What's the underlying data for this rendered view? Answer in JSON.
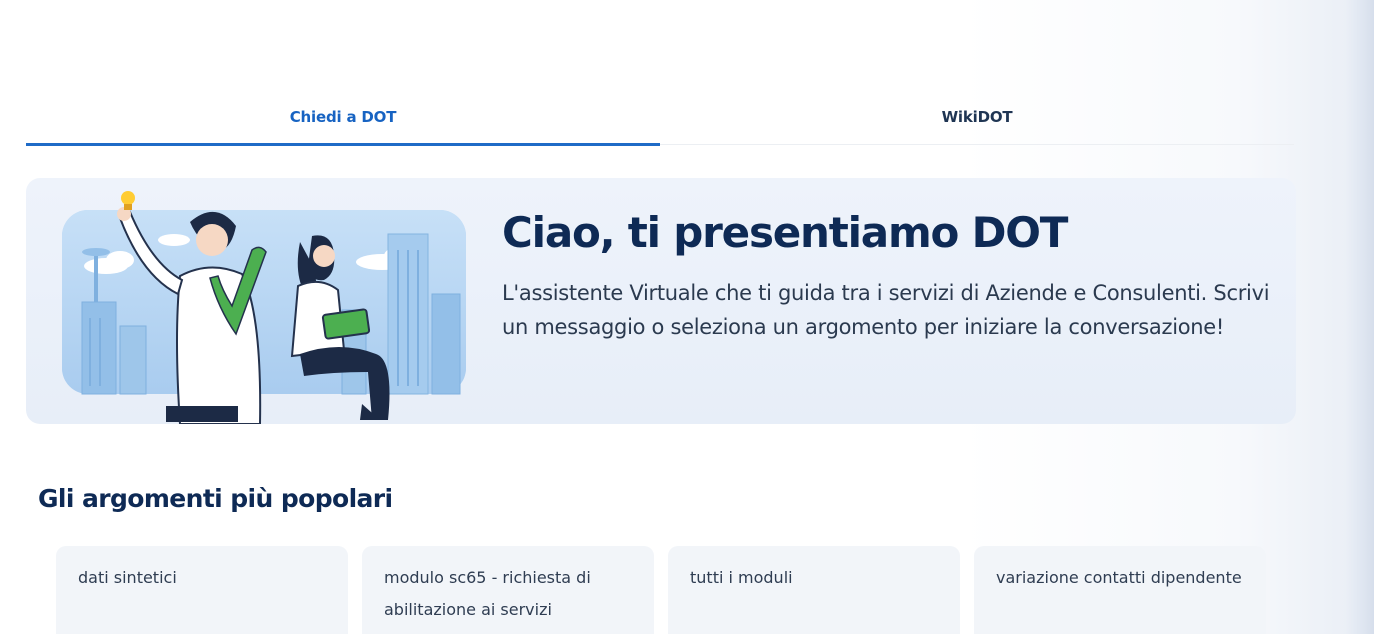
{
  "tabs": [
    {
      "label": "Chiedi a DOT",
      "active": true
    },
    {
      "label": "WikiDOT",
      "active": false
    }
  ],
  "hero": {
    "title": "Ciao, ti presentiamo DOT",
    "text": "L'assistente Virtuale che ti guida tra i servizi di Aziende e Consulenti. Scrivi un messaggio o seleziona un argomento per iniziare la conversazione!"
  },
  "popular": {
    "title": "Gli argomenti più popolari",
    "topics": [
      {
        "label": "dati sintetici"
      },
      {
        "label": "modulo sc65 - richiesta di abilitazione ai servizi"
      },
      {
        "label": "tutti i moduli"
      },
      {
        "label": "variazione contatti dipendente"
      }
    ]
  },
  "colors": {
    "accent": "#1f6bc7",
    "heading": "#0e2a55",
    "hero_bg": "#eef3fb"
  },
  "icons": {
    "hero": "virtual-assistant-illustration"
  }
}
